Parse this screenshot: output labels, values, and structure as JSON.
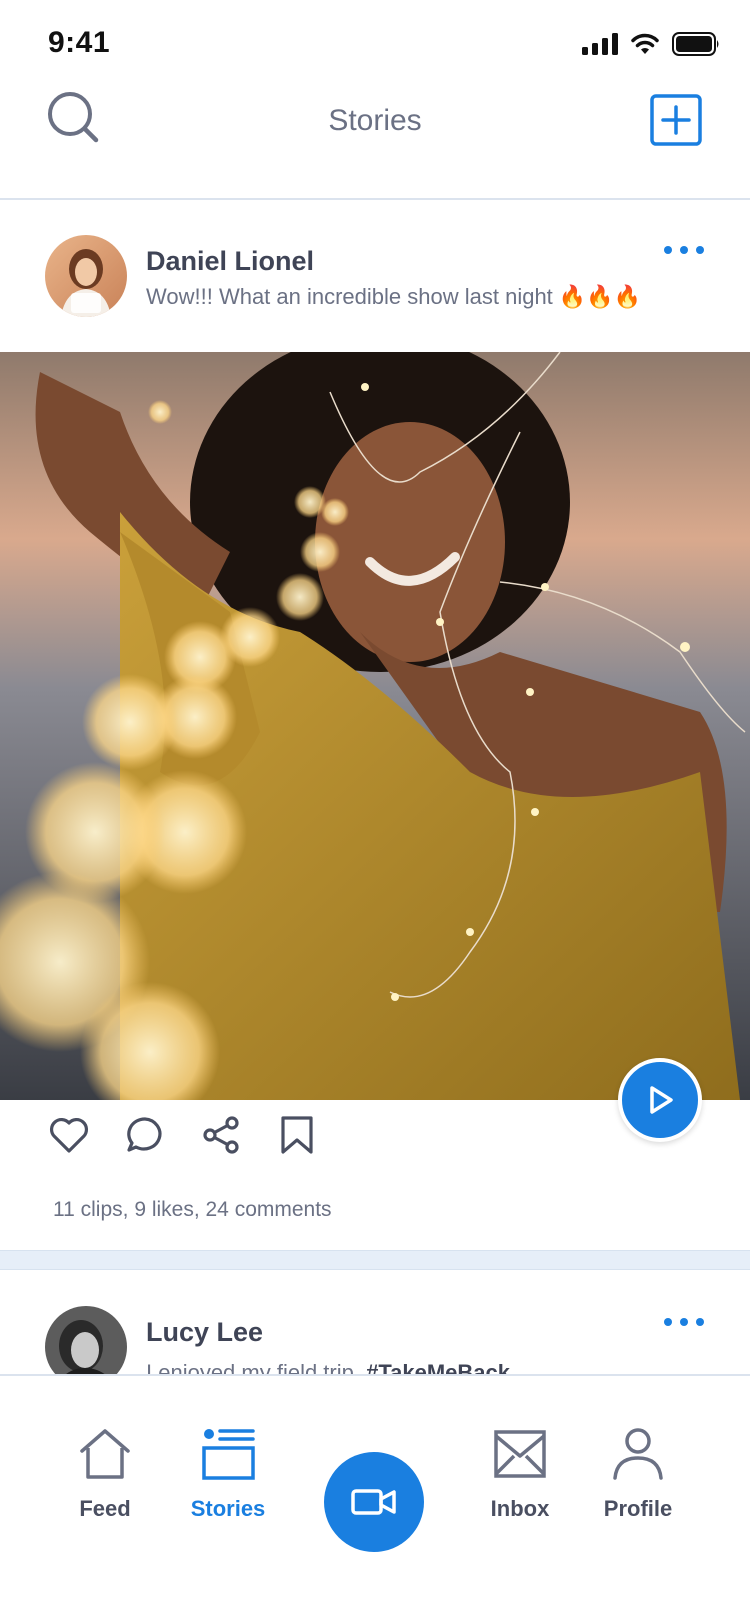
{
  "status_bar": {
    "time": "9:41"
  },
  "header": {
    "title": "Stories"
  },
  "posts": [
    {
      "author": "Daniel Lionel",
      "text": "Wow!!! What an incredible show last night 🔥🔥🔥",
      "stats": "11 clips, 9 likes, 24 comments"
    },
    {
      "author": "Lucy Lee",
      "text_plain": "I enjoyed my field trip.",
      "hashtag": "#TakeMeBack"
    }
  ],
  "tabs": [
    {
      "label": "Feed"
    },
    {
      "label": "Stories"
    },
    {
      "label": "Inbox"
    },
    {
      "label": "Profile"
    }
  ],
  "colors": {
    "accent": "#1a7fe0",
    "text": "#3f4456",
    "muted": "#6b7184",
    "divider": "#e6eef8"
  }
}
